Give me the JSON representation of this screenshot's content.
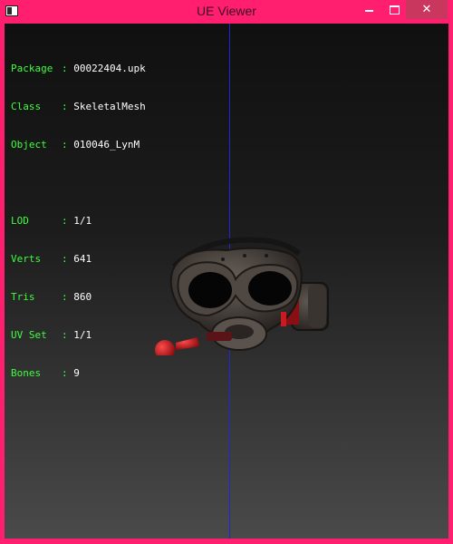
{
  "window": {
    "title": "UE Viewer",
    "buttons": {
      "minimize": "minimize",
      "maximize": "maximize",
      "close": "✕"
    }
  },
  "info": {
    "package": {
      "label": "Package",
      "value": "00022404.upk"
    },
    "class": {
      "label": "Class",
      "value": "SkeletalMesh"
    },
    "object": {
      "label": "Object",
      "value": "010046_LynM"
    },
    "lod": {
      "label": "LOD",
      "value": "1/1"
    },
    "verts": {
      "label": "Verts",
      "value": "641"
    },
    "tris": {
      "label": "Tris",
      "value": "860"
    },
    "uvset": {
      "label": "UV Set",
      "value": "1/1"
    },
    "bones": {
      "label": "Bones",
      "value": "9"
    }
  },
  "colors": {
    "frame": "#ff1f6e",
    "close_button": "#c9375f",
    "info_label": "#3cff3c",
    "info_value": "#ffffff",
    "axis_line": "#1a2bd6",
    "mesh_red": "#d0121a"
  },
  "icons": {
    "app": "ue-viewer-app-icon",
    "mesh": "gas-mask-mesh"
  }
}
